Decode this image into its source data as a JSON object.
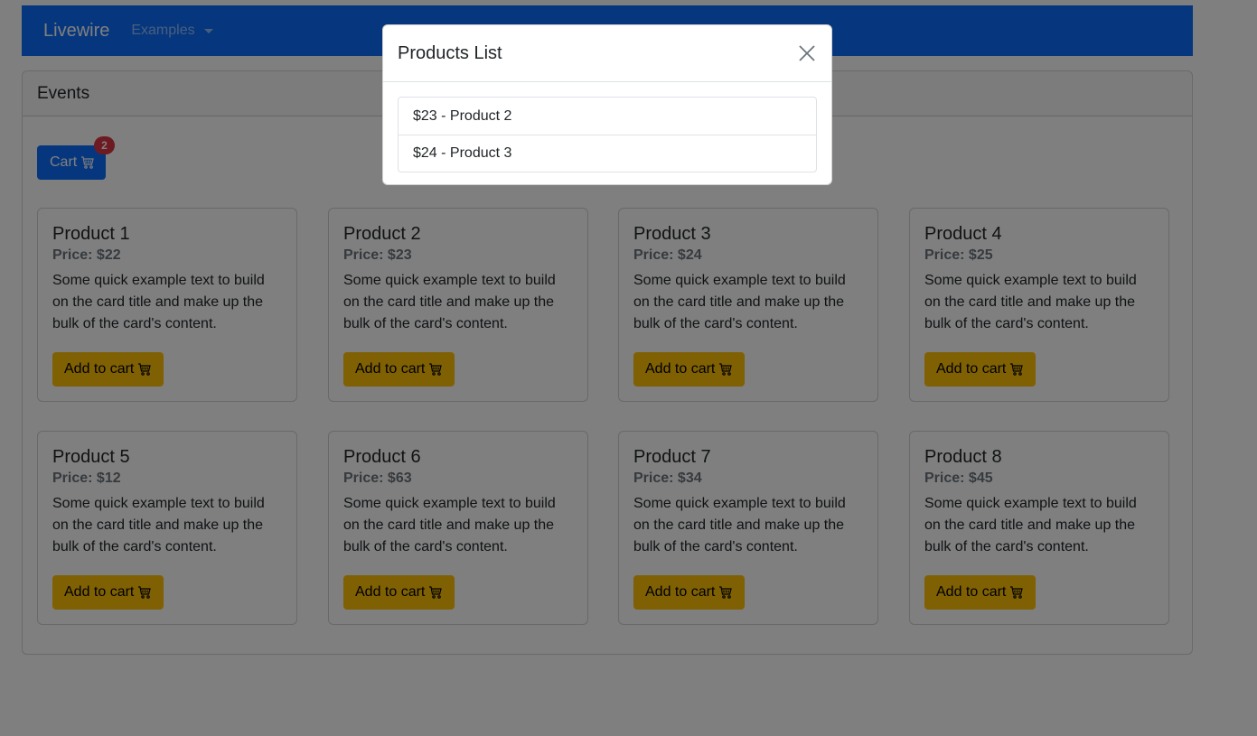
{
  "navbar": {
    "brand": "Livewire",
    "dropdown_label": "Examples"
  },
  "events": {
    "header": "Events",
    "cart_label": "Cart",
    "cart_count": "2"
  },
  "products": [
    {
      "title": "Product 1",
      "price": "Price: $22",
      "text": "Some quick example text to build on the card title and make up the bulk of the card's content.",
      "button": "Add to cart"
    },
    {
      "title": "Product 2",
      "price": "Price: $23",
      "text": "Some quick example text to build on the card title and make up the bulk of the card's content.",
      "button": "Add to cart"
    },
    {
      "title": "Product 3",
      "price": "Price: $24",
      "text": "Some quick example text to build on the card title and make up the bulk of the card's content.",
      "button": "Add to cart"
    },
    {
      "title": "Product 4",
      "price": "Price: $25",
      "text": "Some quick example text to build on the card title and make up the bulk of the card's content.",
      "button": "Add to cart"
    },
    {
      "title": "Product 5",
      "price": "Price: $12",
      "text": "Some quick example text to build on the card title and make up the bulk of the card's content.",
      "button": "Add to cart"
    },
    {
      "title": "Product 6",
      "price": "Price: $63",
      "text": "Some quick example text to build on the card title and make up the bulk of the card's content.",
      "button": "Add to cart"
    },
    {
      "title": "Product 7",
      "price": "Price: $34",
      "text": "Some quick example text to build on the card title and make up the bulk of the card's content.",
      "button": "Add to cart"
    },
    {
      "title": "Product 8",
      "price": "Price: $45",
      "text": "Some quick example text to build on the card title and make up the bulk of the card's content.",
      "button": "Add to cart"
    }
  ],
  "modal": {
    "title": "Products List",
    "items": [
      "$23 - Product 2",
      "$24 - Product 3"
    ]
  },
  "icons": {
    "cart": "cart-icon",
    "close": "close-icon",
    "caret": "caret-down-icon"
  },
  "colors": {
    "primary": "#0d6efd",
    "warning": "#ffc107",
    "danger": "#dc3545"
  }
}
